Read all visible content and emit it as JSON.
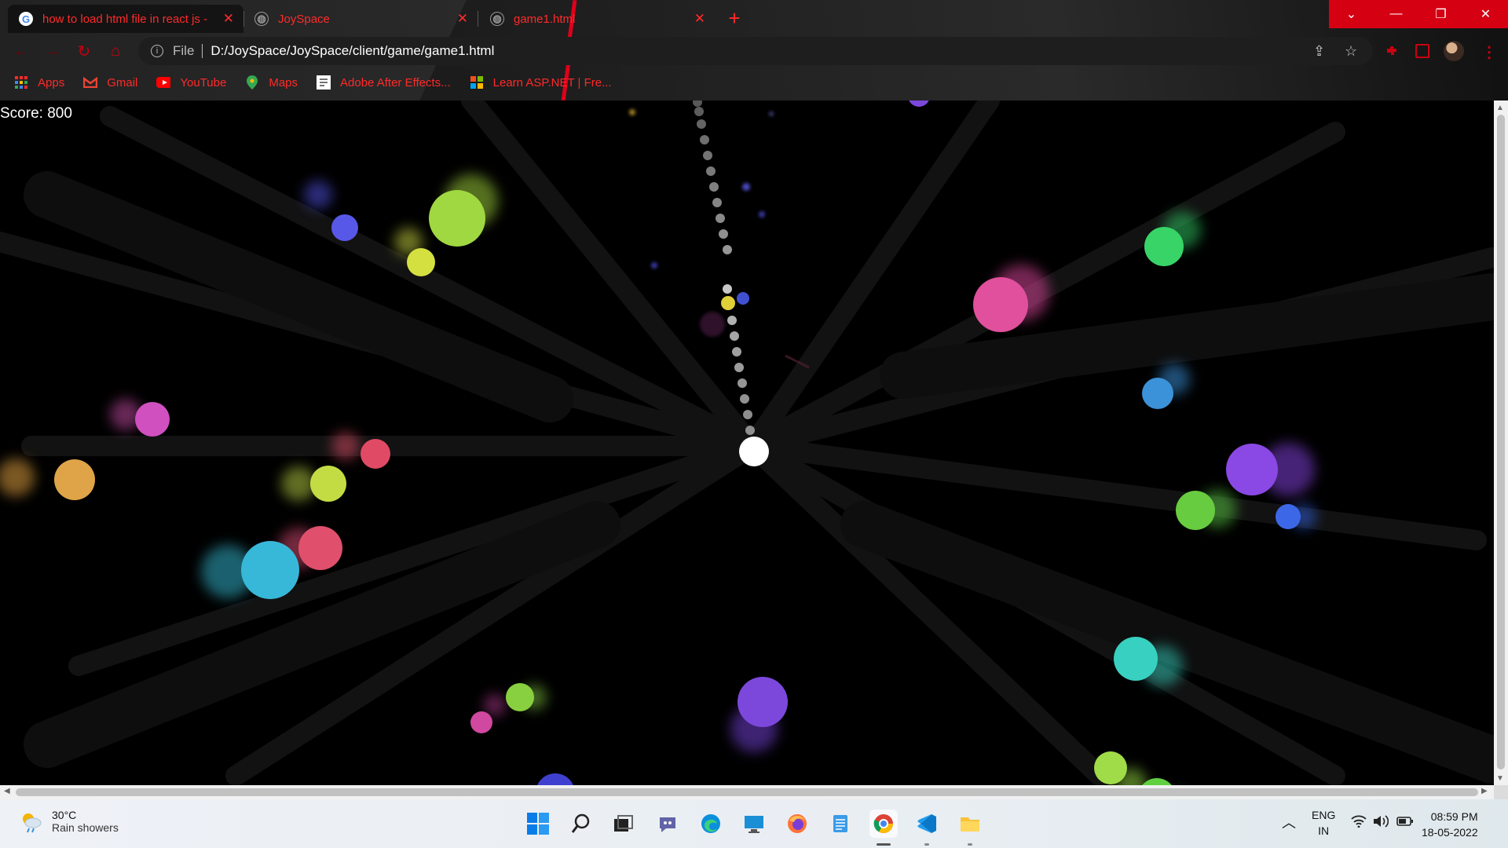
{
  "browser": {
    "tabs": [
      {
        "label": "how to load html file in react js -",
        "favicon": "google-icon",
        "active": true
      },
      {
        "label": "JoySpace",
        "favicon": "globe-icon",
        "active": false
      },
      {
        "label": "game1.html",
        "favicon": "globe-icon",
        "active": false
      }
    ],
    "address": {
      "scheme": "File",
      "url": "D:/JoySpace/JoySpace/client/game/game1.html"
    },
    "bookmarks": [
      {
        "label": "Apps",
        "icon": "apps-grid-icon"
      },
      {
        "label": "Gmail",
        "icon": "gmail-icon"
      },
      {
        "label": "YouTube",
        "icon": "youtube-icon"
      },
      {
        "label": "Maps",
        "icon": "maps-pin-icon"
      },
      {
        "label": "Adobe After Effects...",
        "icon": "document-icon"
      },
      {
        "label": "Learn ASP.NET | Fre...",
        "icon": "windows-icon"
      }
    ],
    "accent_color": "#e0001a"
  },
  "game": {
    "score_text": "Score: 800",
    "player_color": "#ffffff",
    "background": "#000000"
  },
  "taskbar": {
    "weather": {
      "temp": "30°C",
      "desc": "Rain showers"
    },
    "apps": [
      "windows-start-icon",
      "search-icon",
      "task-view-icon",
      "teams-chat-icon",
      "edge-icon",
      "remote-desktop-icon",
      "firefox-icon",
      "notepad-icon",
      "chrome-icon",
      "vscode-icon",
      "file-explorer-icon"
    ],
    "language": {
      "line1": "ENG",
      "line2": "IN"
    },
    "time": "08:59 PM",
    "date": "18-05-2022"
  }
}
